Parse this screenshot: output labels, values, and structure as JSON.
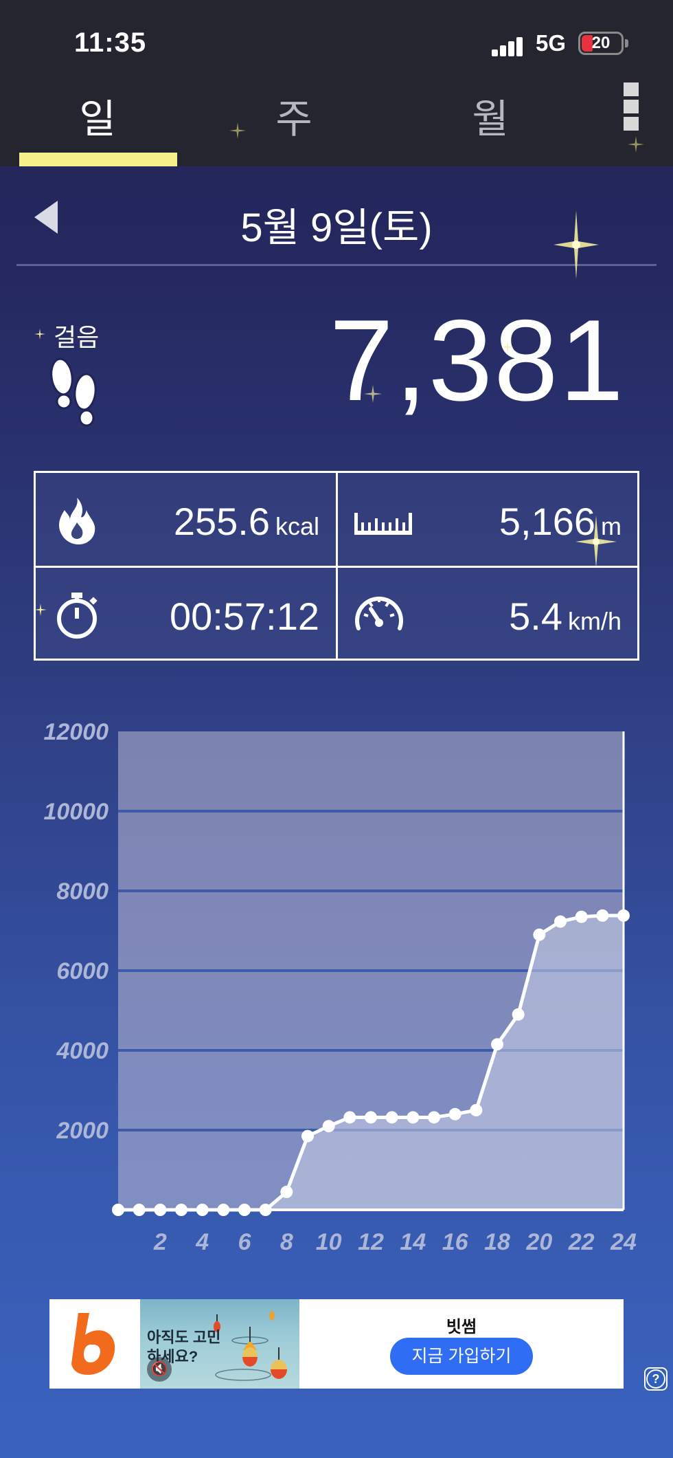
{
  "status": {
    "time": "11:35",
    "network": "5G",
    "battery": "20"
  },
  "tabs": [
    {
      "label": "일"
    },
    {
      "label": "주"
    },
    {
      "label": "월"
    }
  ],
  "date": {
    "title": "5월 9일(토)"
  },
  "steps": {
    "label": "걸음",
    "value": "7,381"
  },
  "stats": {
    "calories": {
      "value": "255.6",
      "unit": "kcal"
    },
    "distance": {
      "value": "5,166",
      "unit": "m"
    },
    "duration": {
      "value": "00:57:12",
      "unit": ""
    },
    "speed": {
      "value": "5.4",
      "unit": "km/h"
    }
  },
  "chart_data": {
    "type": "area",
    "title": "",
    "xlabel": "",
    "ylabel": "",
    "ylim": [
      0,
      12000
    ],
    "xlim": [
      0,
      24
    ],
    "yticks": [
      2000,
      4000,
      6000,
      8000,
      10000,
      12000
    ],
    "xticks": [
      2,
      4,
      6,
      8,
      10,
      12,
      14,
      16,
      18,
      20,
      22,
      24
    ],
    "grid": true,
    "x": [
      0,
      1,
      2,
      3,
      4,
      5,
      6,
      7,
      8,
      9,
      10,
      11,
      12,
      13,
      14,
      15,
      16,
      17,
      18,
      19,
      20,
      21,
      22,
      23,
      24
    ],
    "y": [
      0,
      0,
      0,
      0,
      0,
      0,
      0,
      0,
      450,
      1850,
      2100,
      2320,
      2320,
      2320,
      2320,
      2320,
      2400,
      2500,
      4150,
      4900,
      6900,
      7230,
      7350,
      7381,
      7381
    ],
    "colors": {
      "line": "#ffffff",
      "fill": "#c9cfe6",
      "grid": "#3e5aa8",
      "tick": "#aeb6d8"
    }
  },
  "ad": {
    "image_text": "아직도 고민하세요?",
    "brand": "빗썸",
    "cta": "지금 가입하기",
    "logo_color": "#f26a1b"
  },
  "help": {
    "label": "?"
  }
}
